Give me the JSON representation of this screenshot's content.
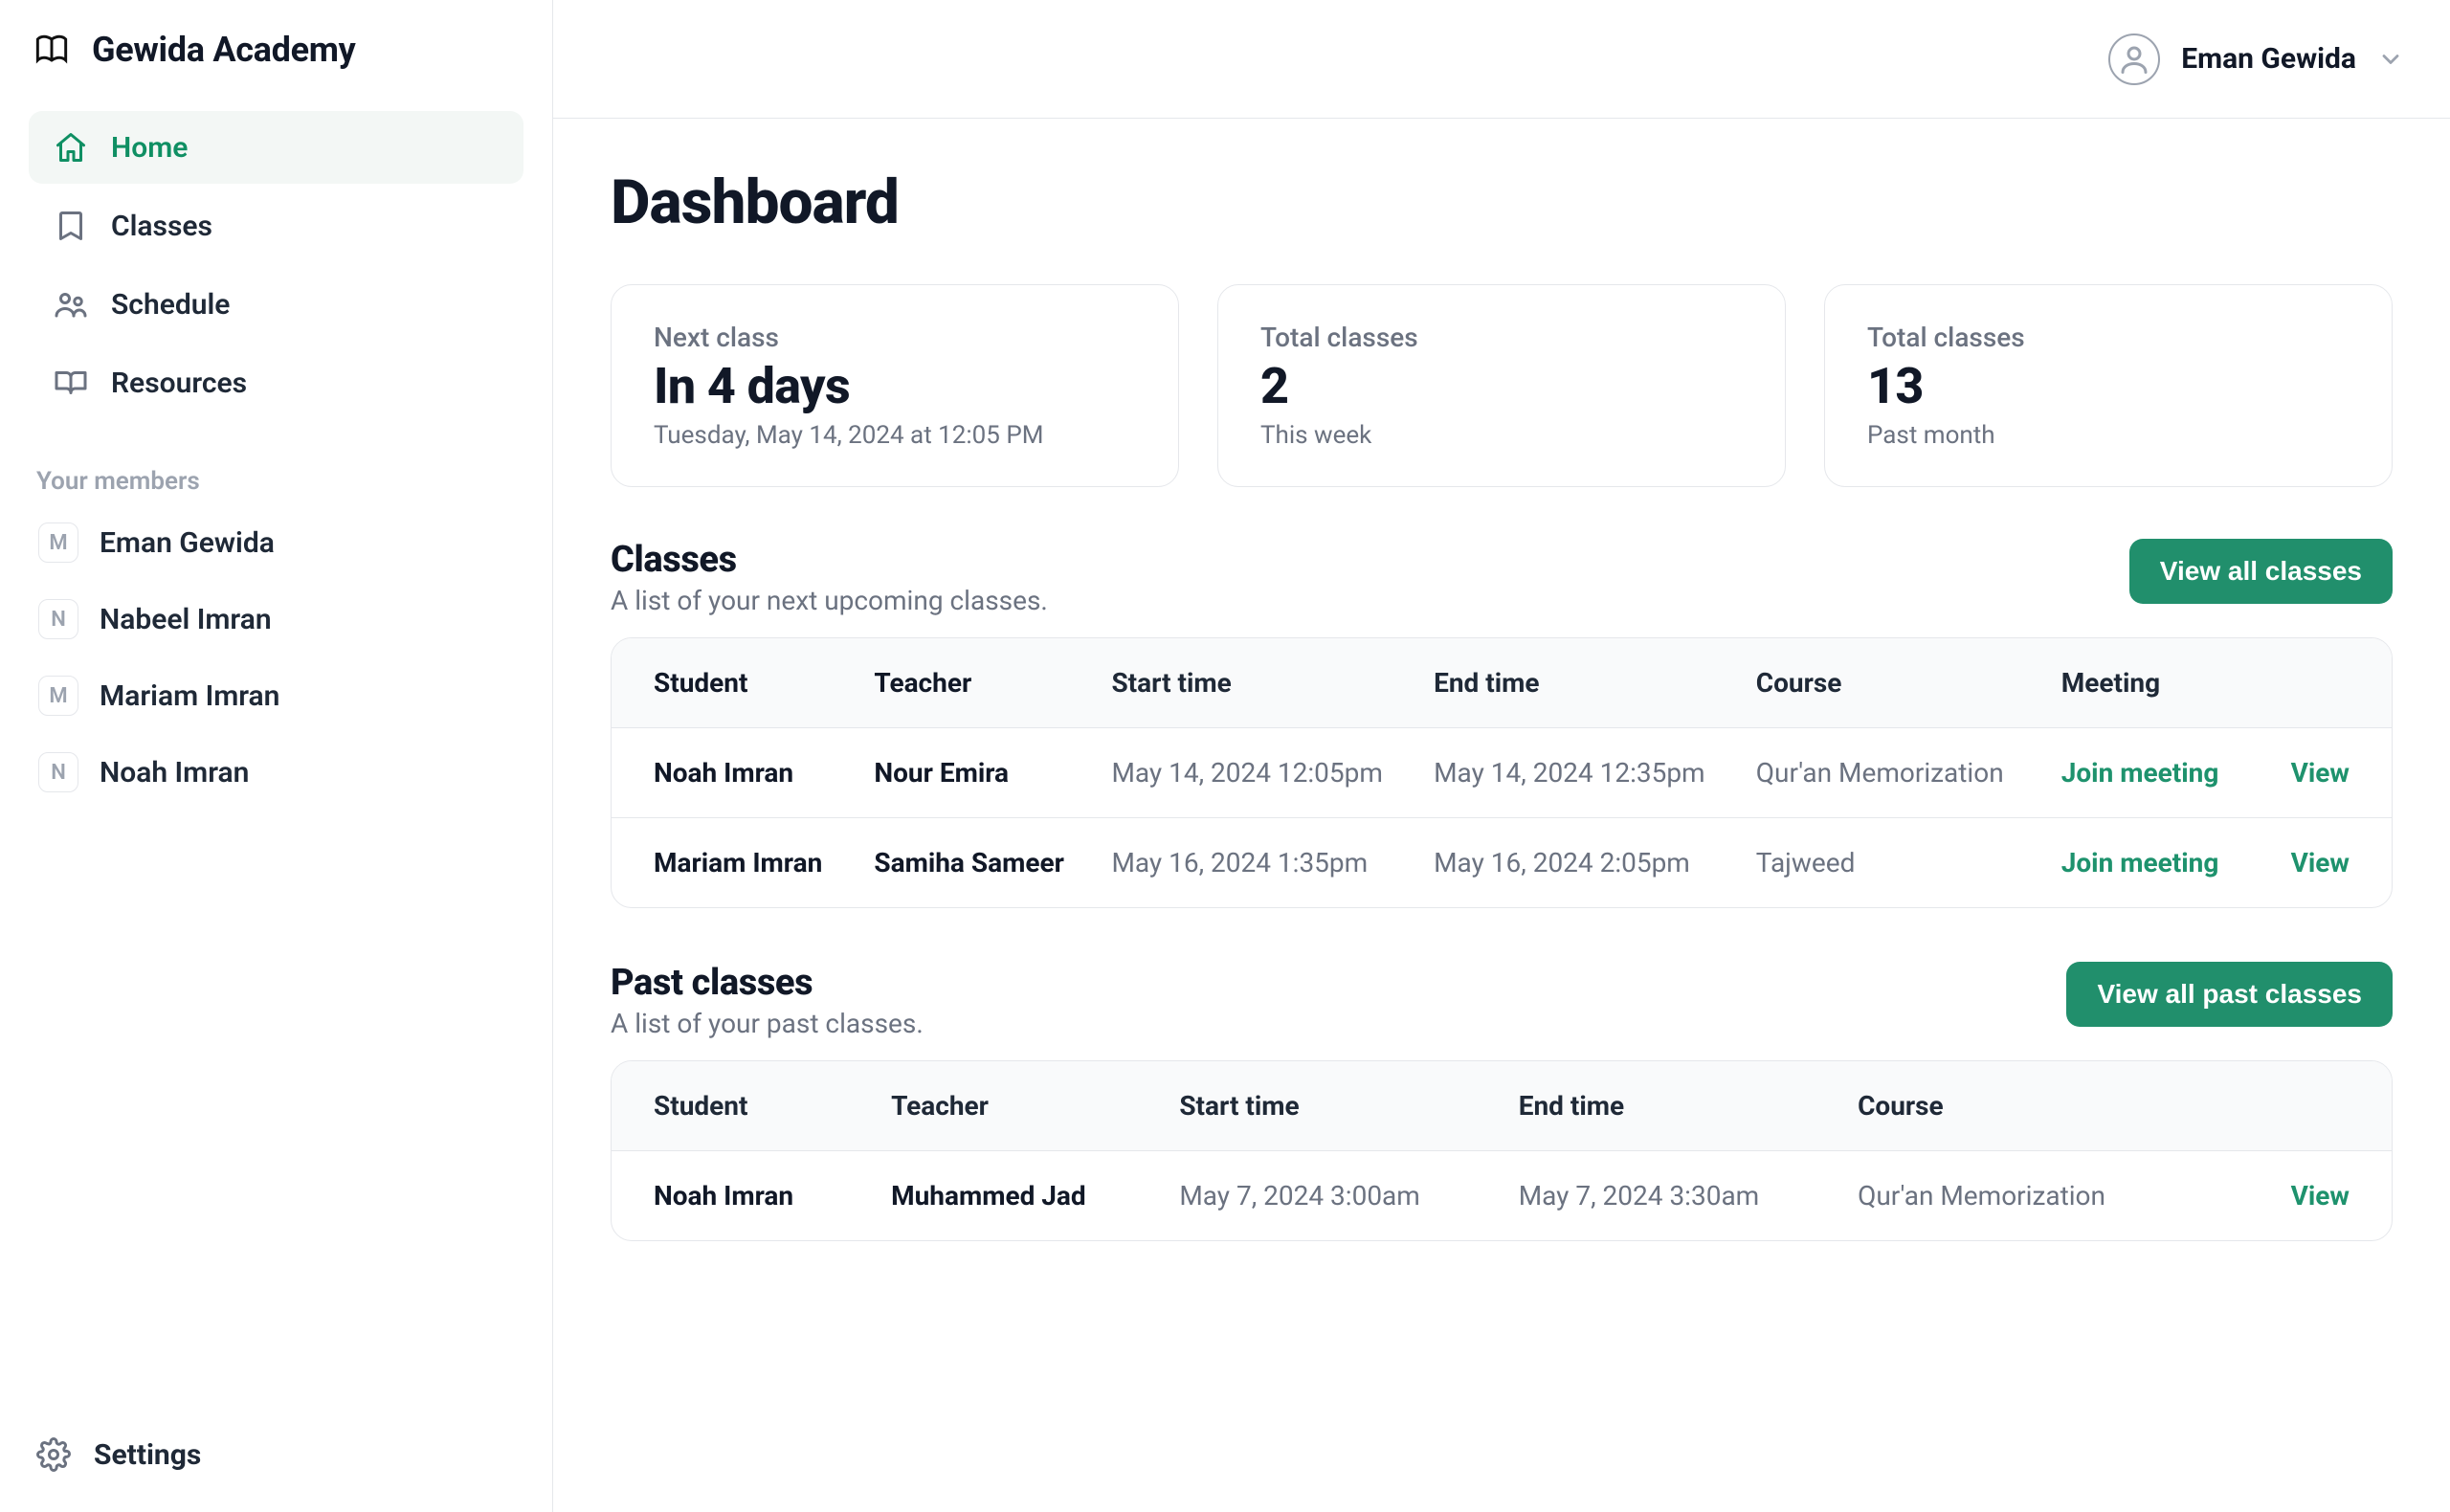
{
  "brand": {
    "name": "Gewida Academy"
  },
  "nav": {
    "home": "Home",
    "classes": "Classes",
    "schedule": "Schedule",
    "resources": "Resources"
  },
  "members_label": "Your members",
  "members": [
    {
      "initial": "M",
      "name": "Eman Gewida"
    },
    {
      "initial": "N",
      "name": "Nabeel Imran"
    },
    {
      "initial": "M",
      "name": "Mariam Imran"
    },
    {
      "initial": "N",
      "name": "Noah Imran"
    }
  ],
  "settings_label": "Settings",
  "topbar": {
    "user_name": "Eman Gewida"
  },
  "page_title": "Dashboard",
  "stats": [
    {
      "label": "Next class",
      "value": "In 4 days",
      "sub": "Tuesday, May 14, 2024 at 12:05 PM"
    },
    {
      "label": "Total classes",
      "value": "2",
      "sub": "This week"
    },
    {
      "label": "Total classes",
      "value": "13",
      "sub": "Past month"
    }
  ],
  "upcoming": {
    "title": "Classes",
    "subtitle": "A list of your next upcoming classes.",
    "button": "View all classes",
    "headers": {
      "student": "Student",
      "teacher": "Teacher",
      "start": "Start time",
      "end": "End time",
      "course": "Course",
      "meeting": "Meeting"
    },
    "rows": [
      {
        "student": "Noah Imran",
        "teacher": "Nour Emira",
        "start": "May 14, 2024 12:05pm",
        "end": "May 14, 2024 12:35pm",
        "course": "Qur'an Memorization",
        "meeting": "Join meeting",
        "view": "View"
      },
      {
        "student": "Mariam Imran",
        "teacher": "Samiha Sameer",
        "start": "May 16, 2024 1:35pm",
        "end": "May 16, 2024 2:05pm",
        "course": "Tajweed",
        "meeting": "Join meeting",
        "view": "View"
      }
    ]
  },
  "past": {
    "title": "Past classes",
    "subtitle": "A list of your past classes.",
    "button": "View all past classes",
    "headers": {
      "student": "Student",
      "teacher": "Teacher",
      "start": "Start time",
      "end": "End time",
      "course": "Course"
    },
    "rows": [
      {
        "student": "Noah Imran",
        "teacher": "Muhammed Jad",
        "start": "May 7, 2024 3:00am",
        "end": "May 7, 2024 3:30am",
        "course": "Qur'an Memorization",
        "view": "View"
      }
    ]
  }
}
